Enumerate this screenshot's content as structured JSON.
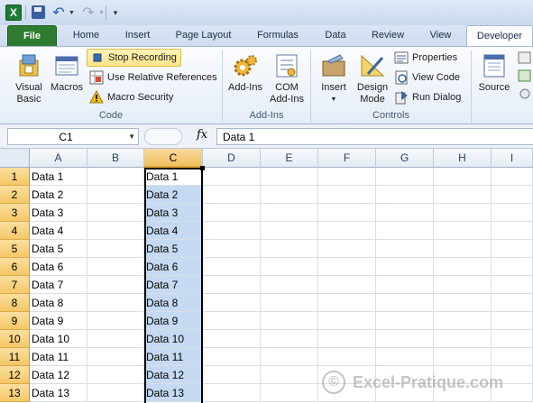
{
  "quick_access": {
    "app_icon": "X",
    "icons": [
      "excel-icon",
      "save-icon",
      "undo-icon",
      "redo-icon",
      "customize-icon"
    ]
  },
  "tabs": [
    "File",
    "Home",
    "Insert",
    "Page Layout",
    "Formulas",
    "Data",
    "Review",
    "View",
    "Developer"
  ],
  "ribbon": {
    "code": {
      "label": "Code",
      "visual_basic": [
        "Visual",
        "Basic"
      ],
      "macros": "Macros",
      "stop_recording": "Stop Recording",
      "relative_refs": "Use Relative References",
      "macro_security": "Macro Security"
    },
    "addins": {
      "label": "Add-Ins",
      "addins_btn": "Add-Ins",
      "com_addins": [
        "COM",
        "Add-Ins"
      ]
    },
    "controls": {
      "label": "Controls",
      "insert": "Insert",
      "design_mode": [
        "Design",
        "Mode"
      ],
      "properties": "Properties",
      "view_code": "View Code",
      "run_dialog": "Run Dialog"
    },
    "source": "Source"
  },
  "formula_bar": {
    "name_box": "C1",
    "fx": "fx",
    "value": "Data 1"
  },
  "grid": {
    "columns": [
      "A",
      "B",
      "C",
      "D",
      "E",
      "F",
      "G",
      "H",
      "I"
    ],
    "rows": [
      {
        "n": "1",
        "a": "Data 1",
        "c": "Data 1"
      },
      {
        "n": "2",
        "a": "Data 2",
        "c": "Data 2"
      },
      {
        "n": "3",
        "a": "Data 3",
        "c": "Data 3"
      },
      {
        "n": "4",
        "a": "Data 4",
        "c": "Data 4"
      },
      {
        "n": "5",
        "a": "Data 5",
        "c": "Data 5"
      },
      {
        "n": "6",
        "a": "Data 6",
        "c": "Data 6"
      },
      {
        "n": "7",
        "a": "Data 7",
        "c": "Data 7"
      },
      {
        "n": "8",
        "a": "Data 8",
        "c": "Data 8"
      },
      {
        "n": "9",
        "a": "Data 9",
        "c": "Data 9"
      },
      {
        "n": "10",
        "a": "Data 10",
        "c": "Data 10"
      },
      {
        "n": "11",
        "a": "Data 11",
        "c": "Data 11"
      },
      {
        "n": "12",
        "a": "Data 12",
        "c": "Data 12"
      },
      {
        "n": "13",
        "a": "Data 13",
        "c": "Data 13"
      }
    ],
    "selected_column": "C",
    "active_cell": "C1"
  },
  "watermark": {
    "symbol": "©",
    "text": "Excel-Pratique.com"
  }
}
